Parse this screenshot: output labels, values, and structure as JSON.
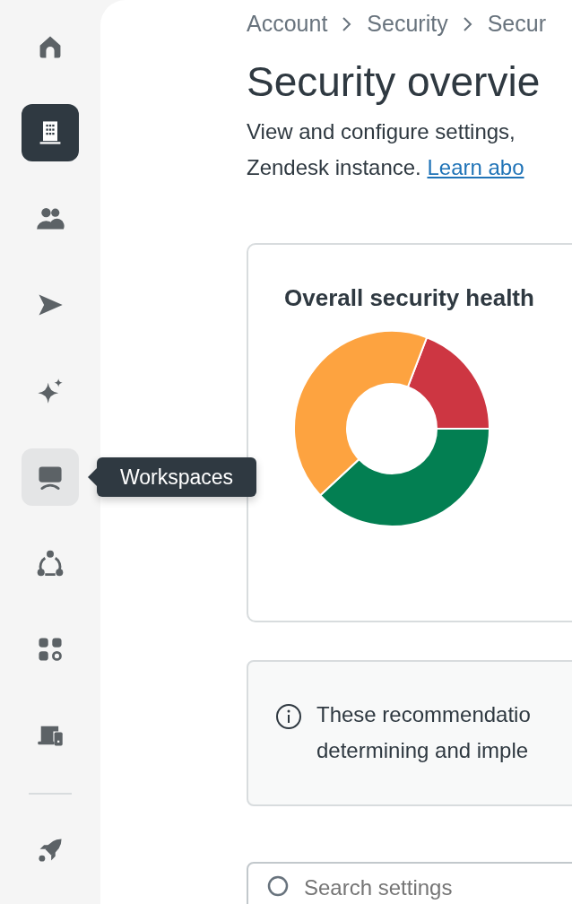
{
  "sidebar": {
    "items": [
      {
        "kind": "home",
        "selected": false,
        "hovered": false
      },
      {
        "kind": "building",
        "selected": true,
        "hovered": false
      },
      {
        "kind": "people",
        "selected": false,
        "hovered": false
      },
      {
        "kind": "send",
        "selected": false,
        "hovered": false
      },
      {
        "kind": "sparkle",
        "selected": false,
        "hovered": false
      },
      {
        "kind": "monitor",
        "selected": false,
        "hovered": true
      },
      {
        "kind": "nodes",
        "selected": false,
        "hovered": false
      },
      {
        "kind": "apps",
        "selected": false,
        "hovered": false
      },
      {
        "kind": "devices",
        "selected": false,
        "hovered": false
      }
    ],
    "footer_items": [
      {
        "kind": "rocket",
        "selected": false,
        "hovered": false
      }
    ]
  },
  "tooltip": {
    "text": "Workspaces"
  },
  "breadcrumb": [
    "Account",
    "Security",
    "Secur"
  ],
  "title": "Security overvie",
  "description": {
    "lines": [
      "View and configure settings,",
      "Zendesk instance."
    ],
    "link": "Learn abo"
  },
  "health_card": {
    "title": "Overall security health"
  },
  "notice": {
    "lines": [
      "These recommendatio",
      "determining and imple"
    ]
  },
  "search": {
    "placeholder": "Search settings"
  }
}
